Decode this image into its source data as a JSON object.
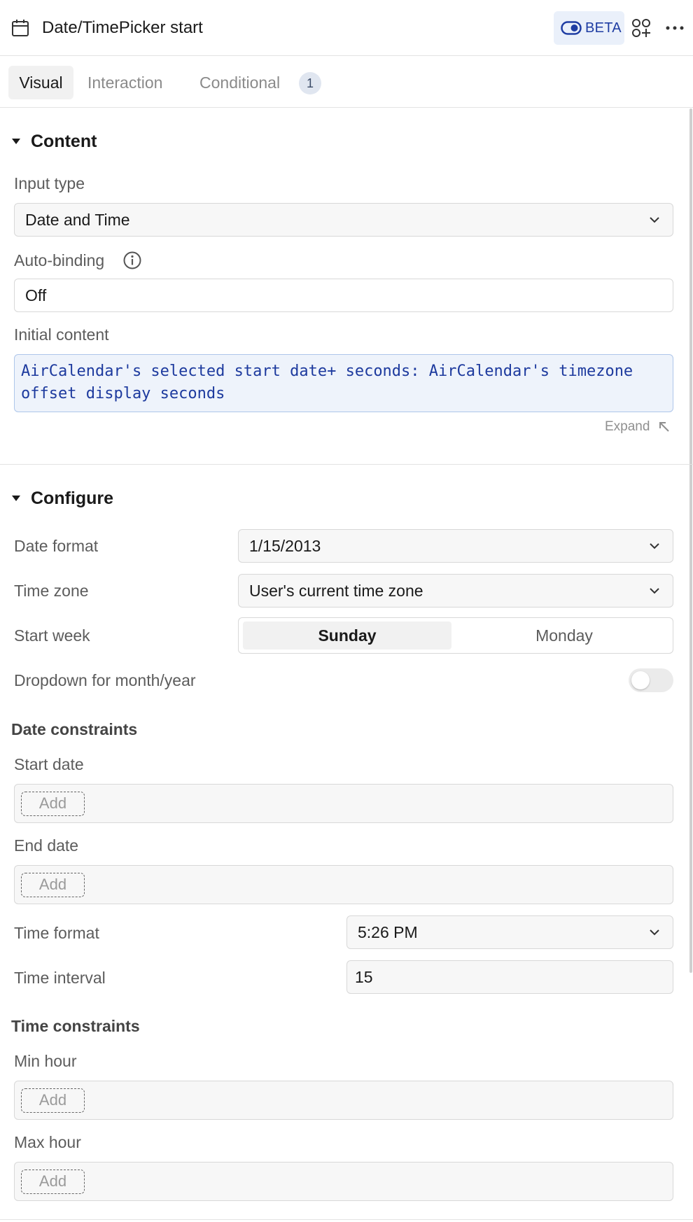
{
  "header": {
    "title": "Date/TimePicker start",
    "beta_label": "BETA",
    "icons": [
      "calendar-icon",
      "toggle-icon",
      "apps-add-icon",
      "more-icon"
    ]
  },
  "tabs": [
    {
      "label": "Visual",
      "active": true
    },
    {
      "label": "Interaction",
      "active": false
    },
    {
      "label": "Conditional",
      "active": false,
      "badge": "1"
    }
  ],
  "content": {
    "title": "Content",
    "input_type": {
      "label": "Input type",
      "value": "Date and Time"
    },
    "auto_binding": {
      "label": "Auto-binding",
      "value": "Off"
    },
    "initial_content": {
      "label": "Initial content",
      "value": "AirCalendar's selected start date+ seconds: AirCalendar's timezone offset display seconds",
      "expand_label": "Expand"
    }
  },
  "configure": {
    "title": "Configure",
    "date_format": {
      "label": "Date format",
      "value": "1/15/2013"
    },
    "time_zone": {
      "label": "Time zone",
      "value": "User's current time zone"
    },
    "start_week": {
      "label": "Start week",
      "options": [
        "Sunday",
        "Monday"
      ],
      "selected": "Sunday"
    },
    "dropdown_month_year": {
      "label": "Dropdown for month/year",
      "enabled": false
    },
    "date_constraints": {
      "title": "Date constraints",
      "start_date": {
        "label": "Start date",
        "add_label": "Add"
      },
      "end_date": {
        "label": "End date",
        "add_label": "Add"
      }
    },
    "time_format": {
      "label": "Time format",
      "value": "5:26 PM"
    },
    "time_interval": {
      "label": "Time interval",
      "value": "15"
    },
    "time_constraints": {
      "title": "Time constraints",
      "min_hour": {
        "label": "Min hour",
        "add_label": "Add"
      },
      "max_hour": {
        "label": "Max hour",
        "add_label": "Add"
      }
    }
  },
  "colors": {
    "accent": "#1f3da3",
    "beta_bg": "#eaf0fa",
    "code_text": "#1d3a9e",
    "code_bg": "#eef3fb"
  }
}
